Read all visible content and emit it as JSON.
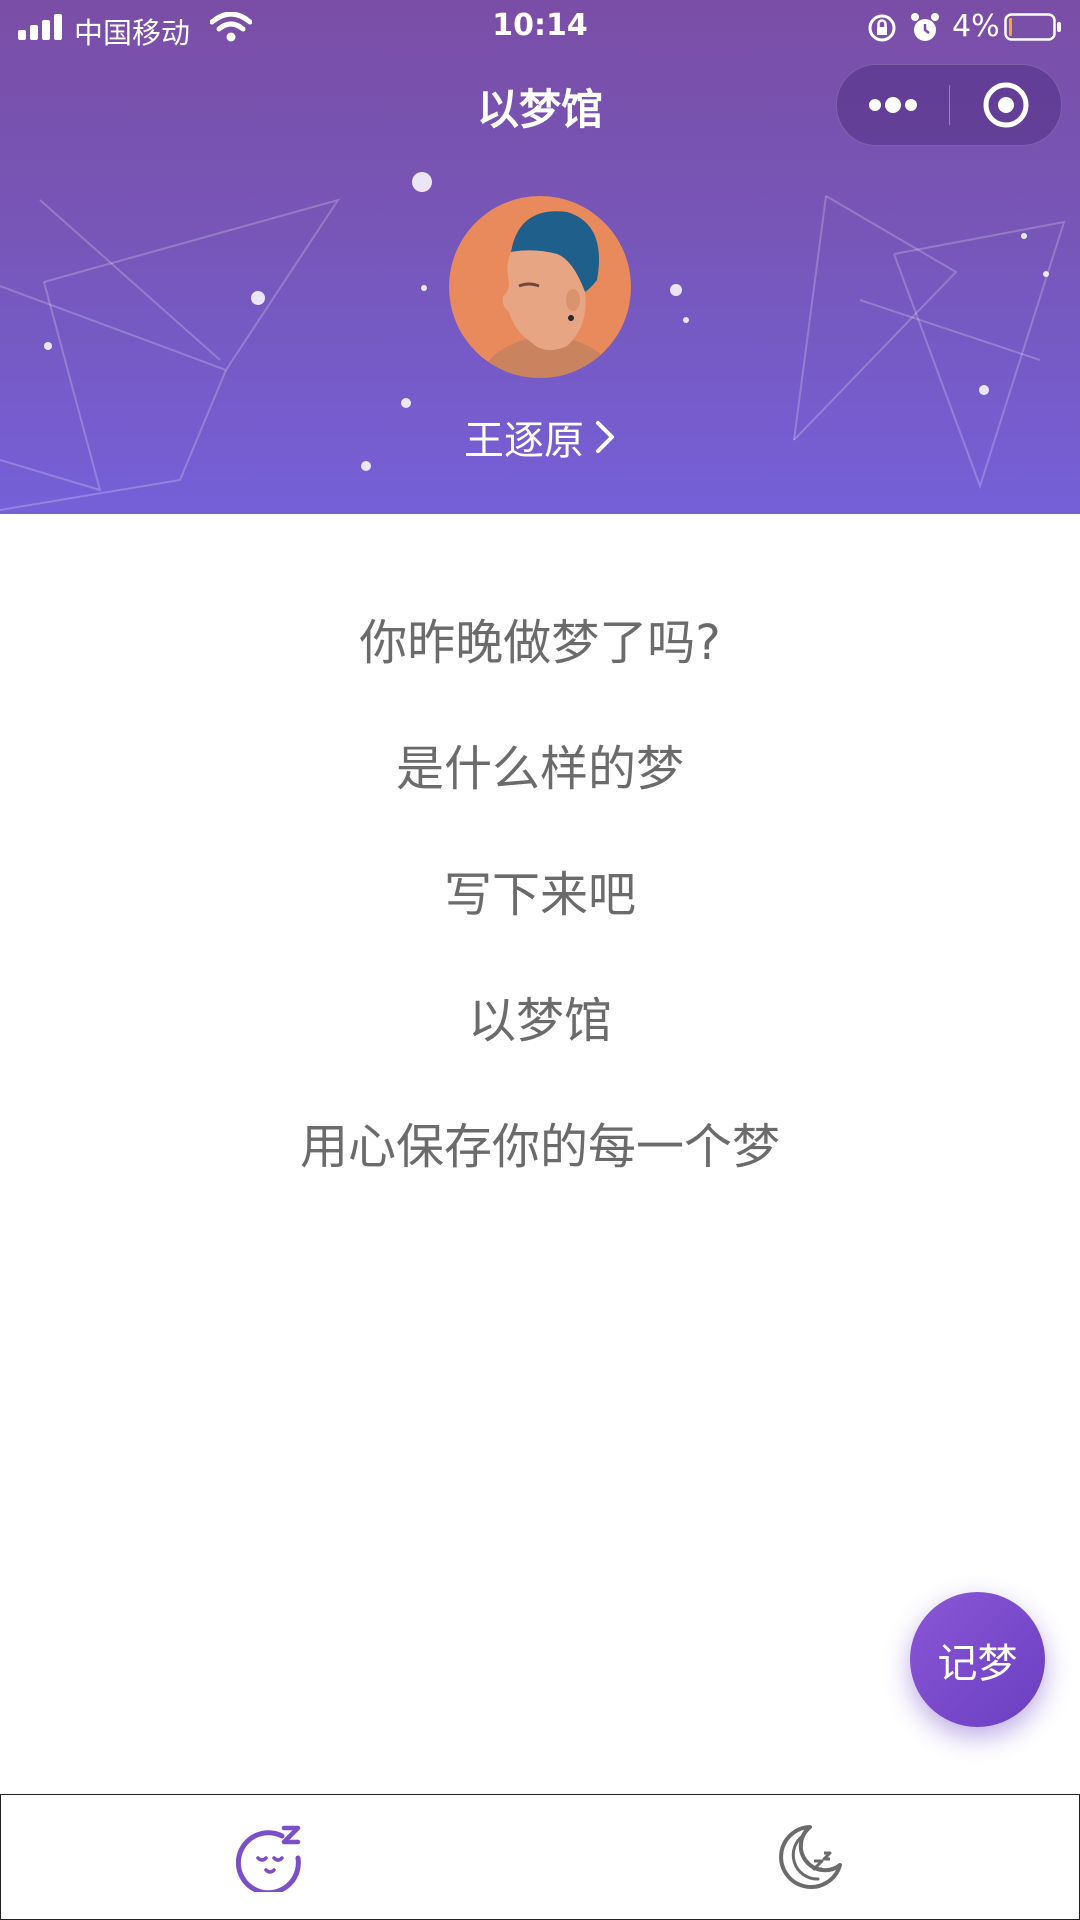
{
  "status_bar": {
    "carrier": "中国移动",
    "time": "10:14",
    "battery_percent": "4%"
  },
  "header": {
    "title": "以梦馆",
    "username": "王逐原",
    "capsule_icons": [
      "more-icon",
      "close-mini-program-icon"
    ]
  },
  "intro_lines": [
    "你昨晚做梦了吗?",
    "是什么样的梦",
    "写下来吧",
    "以梦馆",
    "用心保存你的每一个梦"
  ],
  "fab": {
    "label": "记梦"
  },
  "tabbar": {
    "items": [
      {
        "icon": "sleepy-face-icon",
        "active": true
      },
      {
        "icon": "moon-sleep-icon",
        "active": false
      }
    ]
  },
  "colors": {
    "header_top": "#7a4ea6",
    "header_bottom": "#7560d8",
    "accent": "#7b4fc9",
    "body_text": "#6b6b6b"
  }
}
